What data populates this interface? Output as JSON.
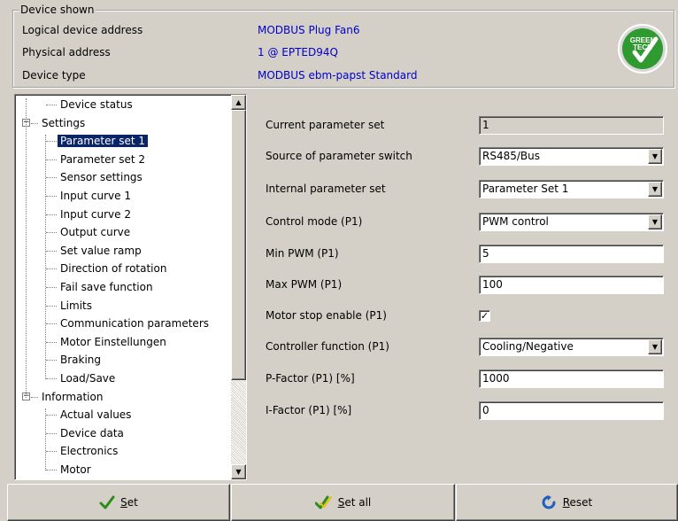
{
  "device_shown": {
    "title": "Device shown",
    "rows": [
      {
        "label": "Logical device address",
        "value": "MODBUS Plug Fan6"
      },
      {
        "label": "Physical address",
        "value": "1 @ EPTED94Q"
      },
      {
        "label": "Device type",
        "value": "MODBUS ebm-papst Standard"
      }
    ],
    "logo_text": "GREEN TECH",
    "logo_color": "#2f9a2f"
  },
  "tree": {
    "items": [
      {
        "label": "Device status",
        "level": 1,
        "expander": ""
      },
      {
        "label": "Settings",
        "level": 0,
        "expander": "−"
      },
      {
        "label": "Parameter set 1",
        "level": 1,
        "selected": true
      },
      {
        "label": "Parameter set 2",
        "level": 1
      },
      {
        "label": "Sensor settings",
        "level": 1
      },
      {
        "label": "Input curve 1",
        "level": 1
      },
      {
        "label": "Input curve 2",
        "level": 1
      },
      {
        "label": "Output curve",
        "level": 1
      },
      {
        "label": "Set value ramp",
        "level": 1
      },
      {
        "label": "Direction of rotation",
        "level": 1
      },
      {
        "label": "Fail save function",
        "level": 1
      },
      {
        "label": "Limits",
        "level": 1
      },
      {
        "label": "Communication parameters",
        "level": 1
      },
      {
        "label": "Motor Einstellungen",
        "level": 1
      },
      {
        "label": "Braking",
        "level": 1
      },
      {
        "label": "Load/Save",
        "level": 1
      },
      {
        "label": "Information",
        "level": 0,
        "expander": "−"
      },
      {
        "label": "Actual values",
        "level": 1
      },
      {
        "label": "Device data",
        "level": 1
      },
      {
        "label": "Electronics",
        "level": 1
      },
      {
        "label": "Motor",
        "level": 1
      }
    ]
  },
  "params": [
    {
      "label": "Current parameter set",
      "kind": "readonly",
      "value": "1"
    },
    {
      "label": "Source of parameter switch",
      "kind": "select",
      "value": "RS485/Bus"
    },
    {
      "label": "Internal parameter set",
      "kind": "select",
      "value": "Parameter Set 1"
    },
    {
      "label": "Control mode (P1)",
      "kind": "select",
      "value": "PWM control"
    },
    {
      "label": "Min PWM (P1)",
      "kind": "input",
      "value": "5"
    },
    {
      "label": "Max PWM (P1)",
      "kind": "input",
      "value": "100"
    },
    {
      "label": "Motor stop enable (P1)",
      "kind": "checkbox",
      "value": "✓"
    },
    {
      "label": "Controller function (P1)",
      "kind": "select",
      "value": "Cooling/Negative"
    },
    {
      "label": "P-Factor (P1) [%]",
      "kind": "input",
      "value": "1000"
    },
    {
      "label": "I-Factor (P1) [%]",
      "kind": "input",
      "value": "0"
    }
  ],
  "buttons": {
    "set": {
      "mnemonic": "S",
      "rest": "et"
    },
    "set_all": {
      "mnemonic": "S",
      "rest": "et all"
    },
    "reset": {
      "mnemonic": "R",
      "rest": "eset"
    }
  },
  "colors": {
    "accent_link": "#0000cc",
    "selection": "#0a246a",
    "check_green": "#2e8b1e",
    "reset_blue": "#1f5fbf"
  }
}
